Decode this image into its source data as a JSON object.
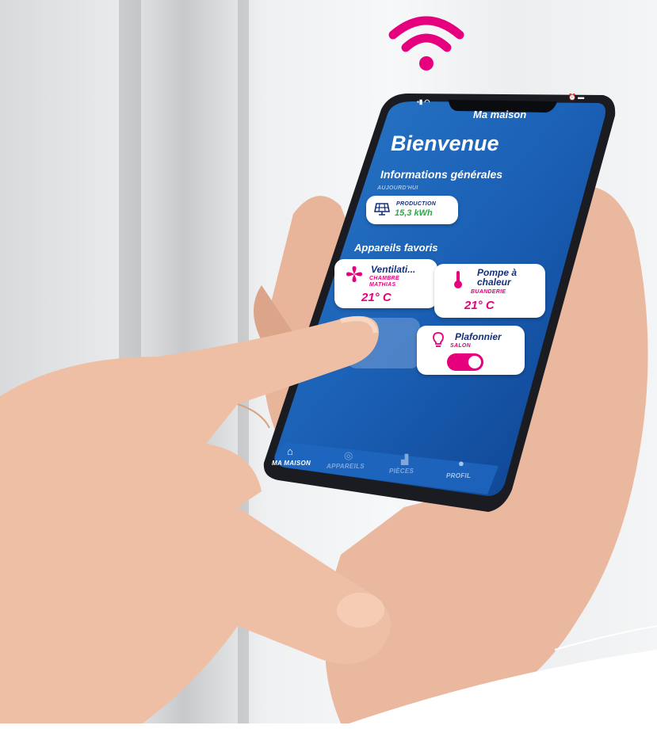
{
  "app": {
    "header_title": "Ma maison",
    "welcome": "Bienvenue"
  },
  "general": {
    "section_title": "Informations générales",
    "subtitle": "AUJOURD'HUI",
    "production": {
      "label": "PRODUCTION",
      "value": "15,3 kWh"
    }
  },
  "favorites": {
    "section_title": "Appareils favoris",
    "cards": [
      {
        "name": "Ventilati...",
        "room": "CHAMBRE MATHIAS",
        "value": "21° C",
        "icon": "fan-icon"
      },
      {
        "name": "Pompe à chaleur",
        "room": "BUANDERIE",
        "value": "21° C",
        "icon": "thermometer-icon"
      },
      {
        "name": "Plafonnier",
        "room": "SALON",
        "state": "on",
        "icon": "lightbulb-icon"
      }
    ]
  },
  "nav": {
    "items": [
      {
        "label": "MA MAISON",
        "icon": "home-icon",
        "active": true
      },
      {
        "label": "APPAREILS",
        "icon": "devices-icon",
        "active": false
      },
      {
        "label": "PIÈCES",
        "icon": "rooms-icon",
        "active": false
      },
      {
        "label": "PROFIL",
        "icon": "profile-icon",
        "active": false
      }
    ]
  },
  "colors": {
    "accent": "#e6007e",
    "screen_blue": "#1a5fb4",
    "production_green": "#2ea84a"
  }
}
